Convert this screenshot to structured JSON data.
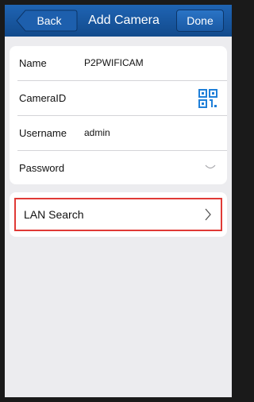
{
  "nav": {
    "back_label": "Back",
    "title": "Add Camera",
    "done_label": "Done"
  },
  "form": {
    "name_label": "Name",
    "name_value": "P2PWIFICAM",
    "camera_id_label": "CameraID",
    "camera_id_value": "",
    "username_label": "Username",
    "username_value": "admin",
    "password_label": "Password",
    "password_value": ""
  },
  "lan": {
    "label": "LAN Search"
  },
  "icons": {
    "qr": "qr-code-icon",
    "password_toggle": "chevron-down-icon",
    "lan_chevron": "chevron-right-icon"
  },
  "colors": {
    "navbar": "#1a5aa4",
    "background": "#ececef",
    "qr": "#1f7fd8",
    "highlight": "#e03a36"
  }
}
